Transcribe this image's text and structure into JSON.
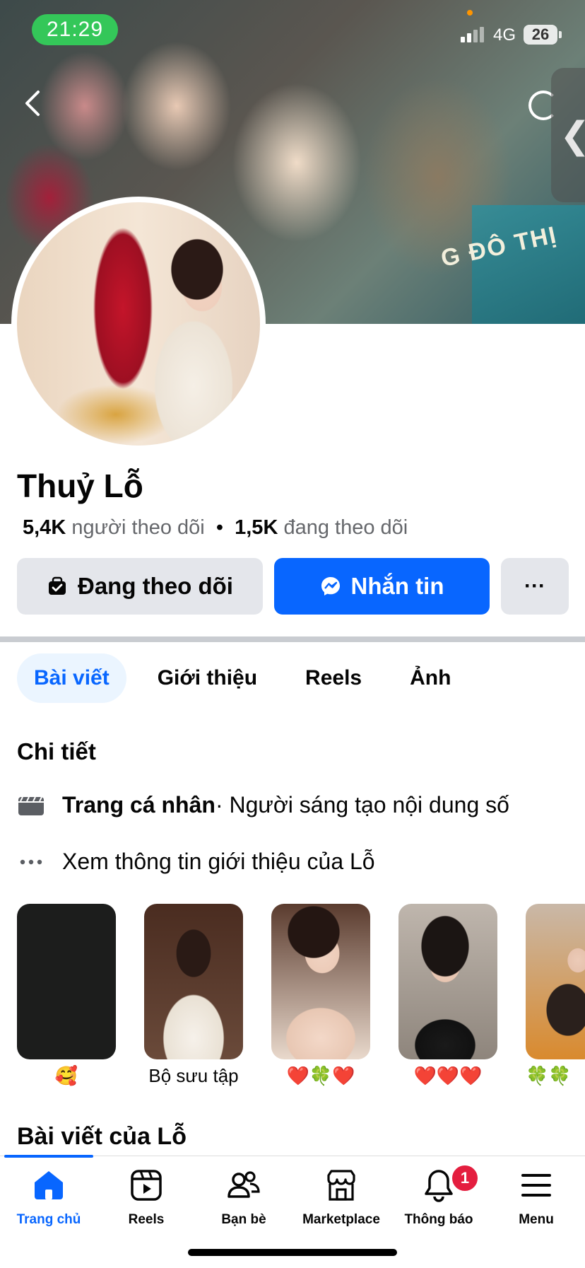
{
  "status_bar": {
    "time": "21:29",
    "network": "4G",
    "battery": "26"
  },
  "cover": {
    "text": "G ĐÔ THỊ"
  },
  "profile": {
    "name": "Thuỷ Lỗ",
    "followers_count": "5,4K",
    "followers_label": "người theo dõi",
    "separator": "•",
    "following_count": "1,5K",
    "following_label": "đang theo dõi"
  },
  "actions": {
    "following": "Đang theo dõi",
    "message": "Nhắn tin",
    "more": "···"
  },
  "tabs": [
    {
      "label": "Bài viết",
      "active": true
    },
    {
      "label": "Giới thiệu"
    },
    {
      "label": "Reels"
    },
    {
      "label": "Ảnh"
    }
  ],
  "details": {
    "title": "Chi tiết",
    "profile_type_bold": "Trang cá nhân",
    "profile_type_rest": " · Người sáng tạo nội dung số",
    "see_about": "Xem thông tin giới thiệu của Lỗ"
  },
  "highlights": [
    {
      "caption": "🥰"
    },
    {
      "caption": "Bộ sưu tập"
    },
    {
      "caption": "❤️🍀❤️"
    },
    {
      "caption": "❤️❤️❤️"
    },
    {
      "caption": "🍀🍀"
    }
  ],
  "posts_title": "Bài viết của Lỗ",
  "nav": {
    "items": [
      {
        "label": "Trang chủ",
        "icon": "home-icon",
        "active": true
      },
      {
        "label": "Reels",
        "icon": "reels-icon"
      },
      {
        "label": "Bạn bè",
        "icon": "friends-icon"
      },
      {
        "label": "Marketplace",
        "icon": "marketplace-icon"
      },
      {
        "label": "Thông báo",
        "icon": "bell-icon",
        "badge": "1"
      },
      {
        "label": "Menu",
        "icon": "menu-icon"
      }
    ]
  },
  "colors": {
    "accent": "#0866ff",
    "button_gray": "#e4e6eb",
    "badge": "#e41e3f",
    "status_green": "#34c759"
  }
}
